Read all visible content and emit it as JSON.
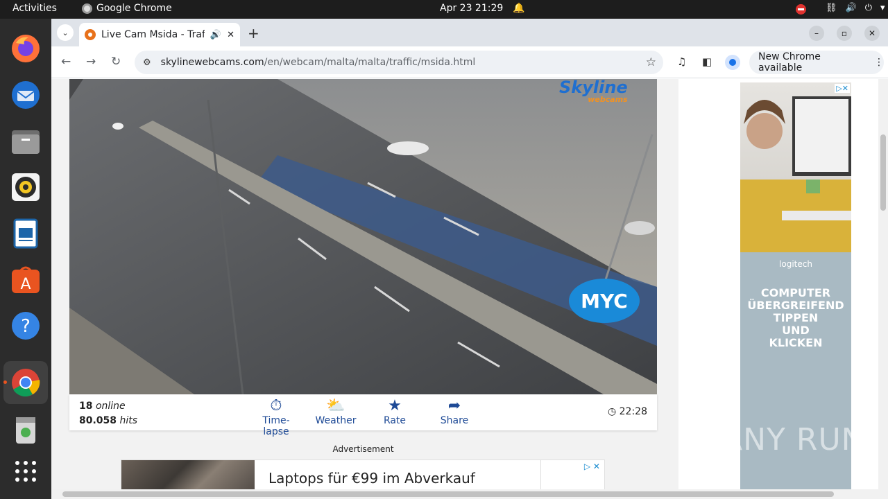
{
  "topbar": {
    "activities": "Activities",
    "app_name": "Google Chrome",
    "datetime": "Apr 23  21:29"
  },
  "dock": {
    "items": [
      "firefox",
      "thunderbird",
      "files",
      "rhythmbox",
      "writer",
      "app-center",
      "help",
      "chrome",
      "trash",
      "show-apps"
    ]
  },
  "browser": {
    "tab_title": "Live Cam Msida - Traffic",
    "url_host": "skylinewebcams.com",
    "url_path": "/en/webcam/malta/malta/traffic/msida.html",
    "update_label": "New Chrome available"
  },
  "webcam": {
    "logo_text": "Skyline",
    "logo_sub": "webcams",
    "overlay_logo": "MYC",
    "online_count": "18",
    "online_label": "online",
    "hits_count": "80.058",
    "hits_label": "hits",
    "actions": [
      "Time-lapse",
      "Weather",
      "Rate",
      "Share"
    ],
    "local_time": "22:28"
  },
  "ads": {
    "label": "Advertisement",
    "banner_text": "Laptops für €99 im Abverkauf",
    "side_brand": "logitech",
    "side_copy_1": "COMPUTER",
    "side_copy_2": "ÜBERGREIFEND",
    "side_copy_3": "TIPPEN",
    "side_copy_4": "UND",
    "side_copy_5": "KLICKEN"
  },
  "watermark": "ANY RUN",
  "colors": {
    "action_blue": "#1e4a96",
    "ubuntu_orange": "#e95420",
    "topbar": "#1d1d1d"
  }
}
